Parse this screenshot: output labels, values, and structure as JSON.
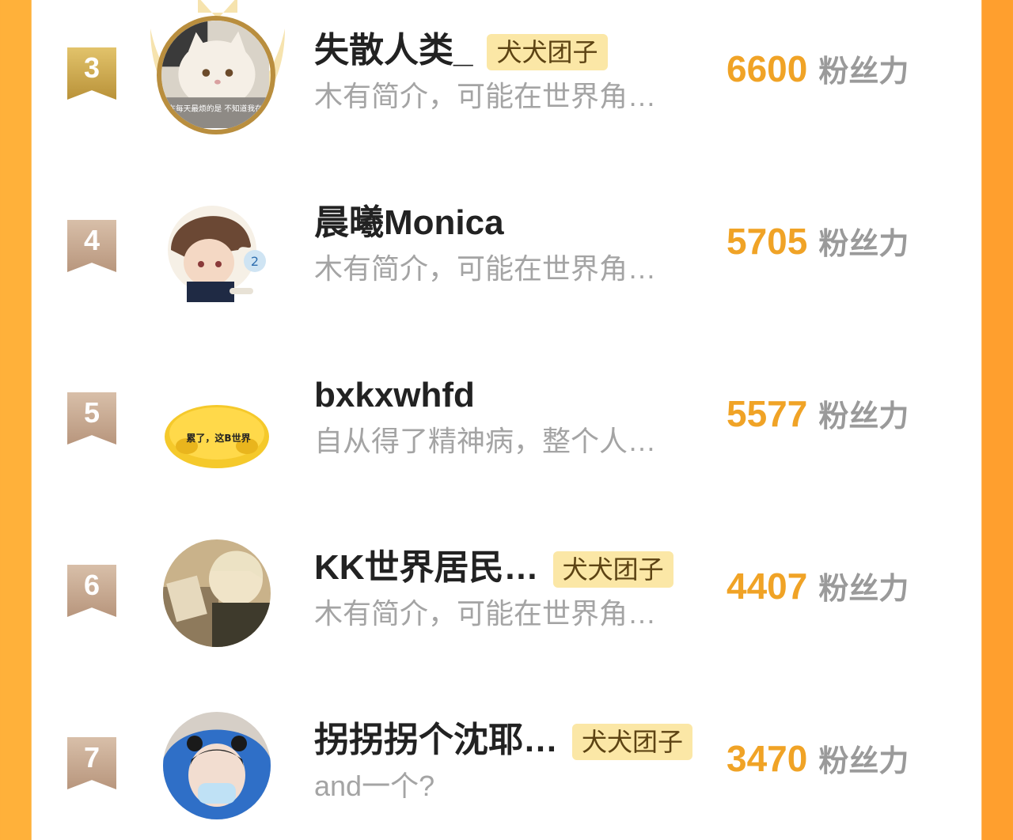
{
  "colors": {
    "accent": "#f0a326",
    "tag_bg": "#fbe7a6",
    "bio": "#a4a4a4",
    "side_orange": "#ffb13a"
  },
  "unit_label": "粉丝力",
  "rows": [
    {
      "rank": "3",
      "name": "失散人类_",
      "tag": "犬犬团子",
      "bio": "木有简介，可能在世界角…",
      "fans": "6600",
      "avatar_text": "我现在每天最烦的是 不知道我在烦什"
    },
    {
      "rank": "4",
      "name": "晨曦Monica",
      "tag": "",
      "bio": "木有简介，可能在世界角…",
      "fans": "5705",
      "avatar_text": ""
    },
    {
      "rank": "5",
      "name": "bxkxwhfd",
      "tag": "",
      "bio": "自从得了精神病，整个人…",
      "fans": "5577",
      "avatar_text": "累了，这B世界"
    },
    {
      "rank": "6",
      "name": "KK世界居民…",
      "tag": "犬犬团子",
      "bio": "木有简介，可能在世界角…",
      "fans": "4407",
      "avatar_text": ""
    },
    {
      "rank": "7",
      "name": "拐拐拐个沈耶…",
      "tag": "犬犬团子",
      "bio": "and一个?",
      "fans": "3470",
      "avatar_text": ""
    }
  ]
}
